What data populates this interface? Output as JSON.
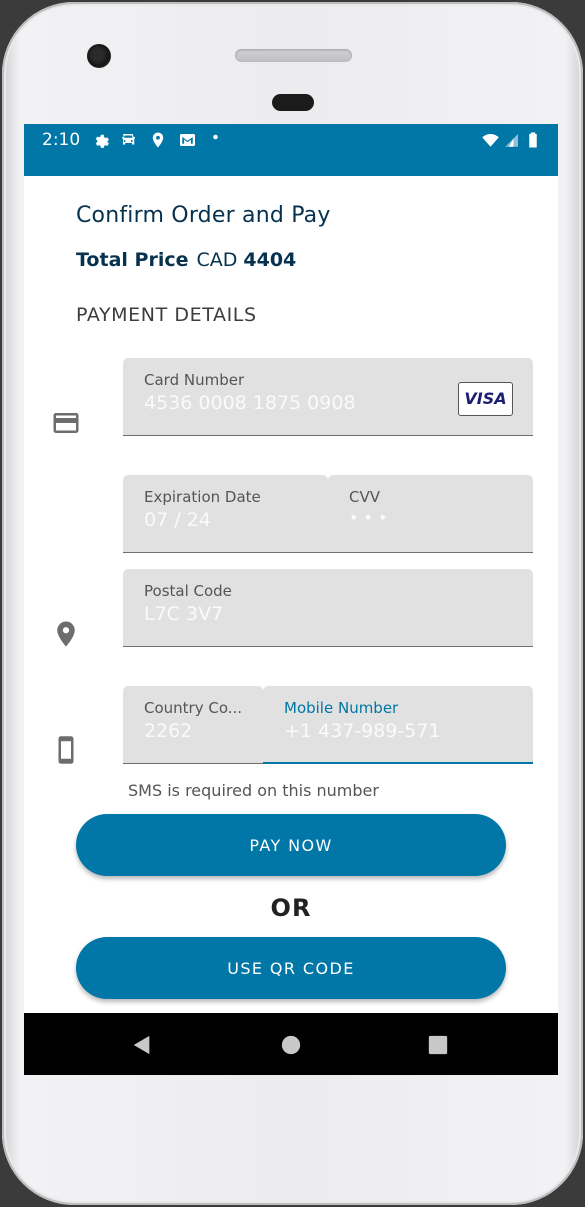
{
  "status_bar": {
    "time": "2:10",
    "icons": [
      "settings-icon",
      "car-icon",
      "location-icon",
      "gmail-icon",
      "dot-icon",
      "wifi-icon",
      "signal-icon",
      "battery-icon"
    ],
    "background": "#0077a6"
  },
  "header": {
    "title": "Confirm Order and Pay",
    "total_label": "Total Price",
    "currency": "CAD",
    "amount": "4404"
  },
  "payment": {
    "section_title": "PAYMENT DETAILS",
    "card_number": {
      "label": "Card Number",
      "value": "4536 0008 1875 0908",
      "brand": "VISA"
    },
    "expiration": {
      "label": "Expiration Date",
      "value": "07 / 24"
    },
    "cvv": {
      "label": "CVV",
      "value": "• • •"
    },
    "postal": {
      "label": "Postal Code",
      "value": "L7C 3V7"
    },
    "country_code": {
      "label": "Country Co...",
      "value": "2262"
    },
    "mobile": {
      "label": "Mobile Number",
      "value": "+1 437-989-571"
    },
    "sms_hint": "SMS is required on this number"
  },
  "actions": {
    "pay_now": "PAY NOW",
    "or": "OR",
    "qr_code": "USE QR CODE"
  },
  "nav_bar": {
    "icons": [
      "back-icon",
      "home-icon",
      "recents-icon"
    ]
  },
  "colors": {
    "accent": "#0077a6",
    "title": "#06324f",
    "field": "#e1e1e1"
  }
}
